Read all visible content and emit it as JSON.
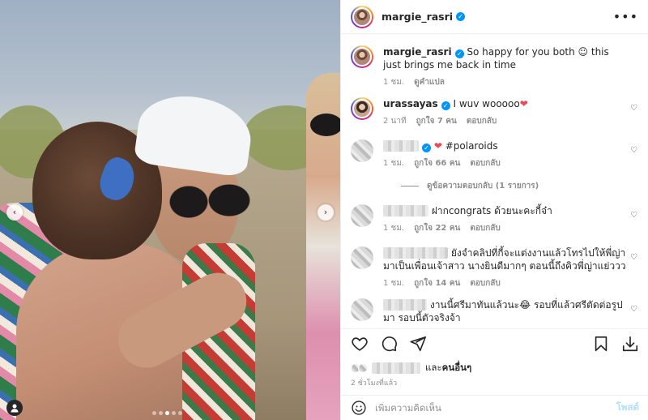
{
  "post": {
    "username": "margie_rasri",
    "more_icon": "more-horizontal-icon",
    "verified_icon": "verified-badge-icon"
  },
  "photo": {
    "prev_arrow": "‹",
    "next_arrow": "›",
    "carousel": {
      "count": 5,
      "active": 2
    }
  },
  "comments": [
    {
      "username": "margie_rasri",
      "text": "So happy for you both ☺ this just brings me back in time",
      "time": "1 ชม.",
      "translate": "ดูคำแปล"
    },
    {
      "username": "urassayas",
      "text_before": "I wuv wooooo",
      "text_after": "❤",
      "time": "2 นาที",
      "likes": "ถูกใจ 7 คน",
      "reply": "ตอบกลับ"
    },
    {
      "text": "#polaroids",
      "time": "1 ชม.",
      "likes": "ถูกใจ 66 คน",
      "reply": "ตอบกลับ",
      "view_replies": "ดูข้อความตอบกลับ (1 รายการ)"
    },
    {
      "text": "ฝากcongrats ด้วยนะคะกี้จ๋า",
      "time": "1 ชม.",
      "likes": "ถูกใจ 22 คน",
      "reply": "ตอบกลับ"
    },
    {
      "text": "ยังจำคลิปที่กี้จะแต่งงานแล้วโทรไปให้พี่ญ่ามาเป็นเพื่อนเจ้าสาว นางยินดีมากๆ ตอนนี้ถึงคิวพี่ญ่าแย่ววว",
      "time": "1 ชม.",
      "likes": "ถูกใจ 14 คน",
      "reply": "ตอบกลับ"
    },
    {
      "text_before": "งานนี้ศรีมาทันแล้วนะ",
      "emoji": "😂",
      "text_after": " รอบที่แล้วศรีตัดต่อรูปมา รอบนี้ตัวจริงจ้า"
    }
  ],
  "actions": {
    "like_icon": "heart-icon",
    "comment_icon": "comment-icon",
    "share_icon": "send-icon",
    "save_icon": "bookmark-icon",
    "download_icon": "download-icon"
  },
  "likes": {
    "others_prefix": "และ",
    "others_link": "คนอื่นๆ"
  },
  "time_ago": "2 ชั่วโมงที่แล้ว",
  "add_comment": {
    "placeholder": "เพิ่มความคิดเห็น",
    "post_label": "โพสต์",
    "emoji_icon": "smiley-icon"
  },
  "colors": {
    "verified_blue": "#0095f6",
    "heart_red": "#ed4956",
    "muted_text": "#8e8e8e",
    "post_disabled": "#b2dffc"
  }
}
